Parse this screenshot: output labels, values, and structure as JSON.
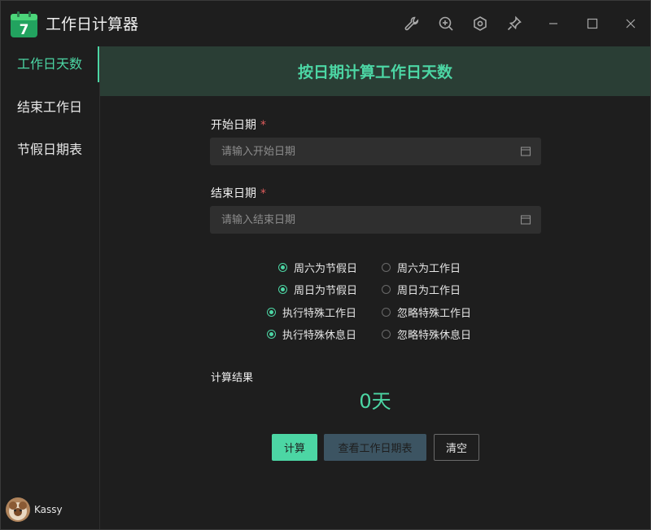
{
  "app": {
    "title": "工作日计算器",
    "icon_number": "7"
  },
  "titlebar": {
    "icons": [
      "wrench-icon",
      "zoom-in-icon",
      "settings-icon",
      "pin-icon",
      "minimize-icon",
      "maximize-icon",
      "close-icon"
    ]
  },
  "sidebar": {
    "items": [
      {
        "label": "工作日天数",
        "active": true
      },
      {
        "label": "结束工作日",
        "active": false
      },
      {
        "label": "节假日期表",
        "active": false
      }
    ],
    "user": {
      "name": "Kassy"
    }
  },
  "main": {
    "title": "按日期计算工作日天数",
    "start_date": {
      "label": "开始日期",
      "required_mark": "*",
      "placeholder": "请输入开始日期",
      "value": ""
    },
    "end_date": {
      "label": "结束日期",
      "required_mark": "*",
      "placeholder": "请输入结束日期",
      "value": ""
    },
    "options": [
      {
        "left": "周六为节假日",
        "right": "周六为工作日",
        "selected": "left"
      },
      {
        "left": "周日为节假日",
        "right": "周日为工作日",
        "selected": "left"
      },
      {
        "left": "执行特殊工作日",
        "right": "忽略特殊工作日",
        "selected": "left"
      },
      {
        "left": "执行特殊休息日",
        "right": "忽略特殊休息日",
        "selected": "left"
      }
    ],
    "result": {
      "label": "计算结果",
      "value": "0天"
    },
    "buttons": {
      "calculate": "计算",
      "view_calendar": "查看工作日期表",
      "clear": "清空"
    }
  },
  "colors": {
    "accent": "#4cd6a4",
    "header_bg": "#2a3e35",
    "background": "#1e1e1e",
    "input_bg": "#2f2f2f"
  }
}
